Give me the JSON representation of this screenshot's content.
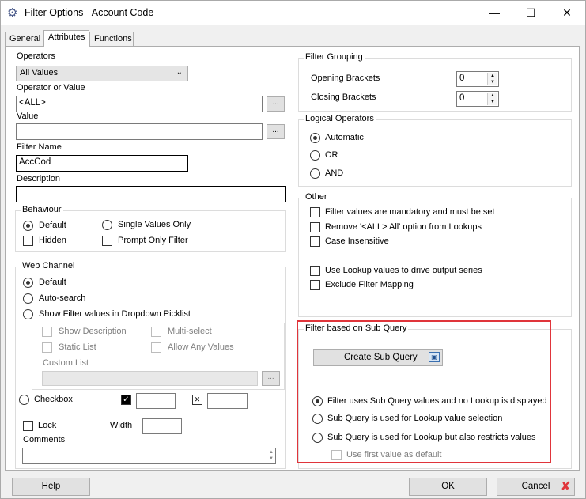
{
  "window": {
    "title": "Filter Options - Account Code",
    "app_icon": "gear-icon"
  },
  "tabs": [
    {
      "label": "General"
    },
    {
      "label": "Attributes"
    },
    {
      "label": "Functions"
    }
  ],
  "left": {
    "operators_label": "Operators",
    "operators_value": "All Values",
    "operator_or_value_label": "Operator or Value",
    "operator_or_value": "<ALL>",
    "value_label": "Value",
    "value": "",
    "filter_name_label": "Filter Name",
    "filter_name": "AccCod",
    "description_label": "Description",
    "description": "",
    "ellipsis": "..."
  },
  "behaviour": {
    "legend": "Behaviour",
    "default": "Default",
    "single_values_only": "Single Values Only",
    "hidden": "Hidden",
    "prompt_only_filter": "Prompt Only Filter"
  },
  "web_channel": {
    "legend": "Web Channel",
    "default": "Default",
    "auto_search": "Auto-search",
    "show_filter_values": "Show Filter values in Dropdown Picklist",
    "show_description": "Show Description",
    "multi_select": "Multi-select",
    "static_list": "Static List",
    "allow_any_values": "Allow Any Values",
    "custom_list": "Custom List",
    "checkbox": "Checkbox"
  },
  "lower_left": {
    "lock": "Lock",
    "width": "Width",
    "comments": "Comments"
  },
  "filter_grouping": {
    "legend": "Filter Grouping",
    "opening_brackets_label": "Opening Brackets",
    "opening_brackets": "0",
    "closing_brackets_label": "Closing Brackets",
    "closing_brackets": "0"
  },
  "logical_operators": {
    "legend": "Logical Operators",
    "automatic": "Automatic",
    "or": "OR",
    "and": "AND"
  },
  "other": {
    "legend": "Other",
    "mandatory": "Filter values are mandatory and must be set",
    "remove_all": "Remove '<ALL> All' option from Lookups",
    "case_insensitive": "Case Insensitive",
    "use_lookup_values": "Use Lookup values to drive output series",
    "exclude_filter_mapping": "Exclude Filter Mapping"
  },
  "sub_query": {
    "legend": "Filter based on Sub Query",
    "create_button": "Create Sub Query",
    "option1": "Filter uses Sub Query values and no Lookup is displayed",
    "option2": "Sub Query is used for Lookup value selection",
    "option3": "Sub Query is used for Lookup but also restricts values",
    "use_first_value": "Use first value as default",
    "highlight_color": "#e0353b"
  },
  "footer": {
    "help": "Help",
    "ok": "OK",
    "cancel": "Cancel"
  }
}
